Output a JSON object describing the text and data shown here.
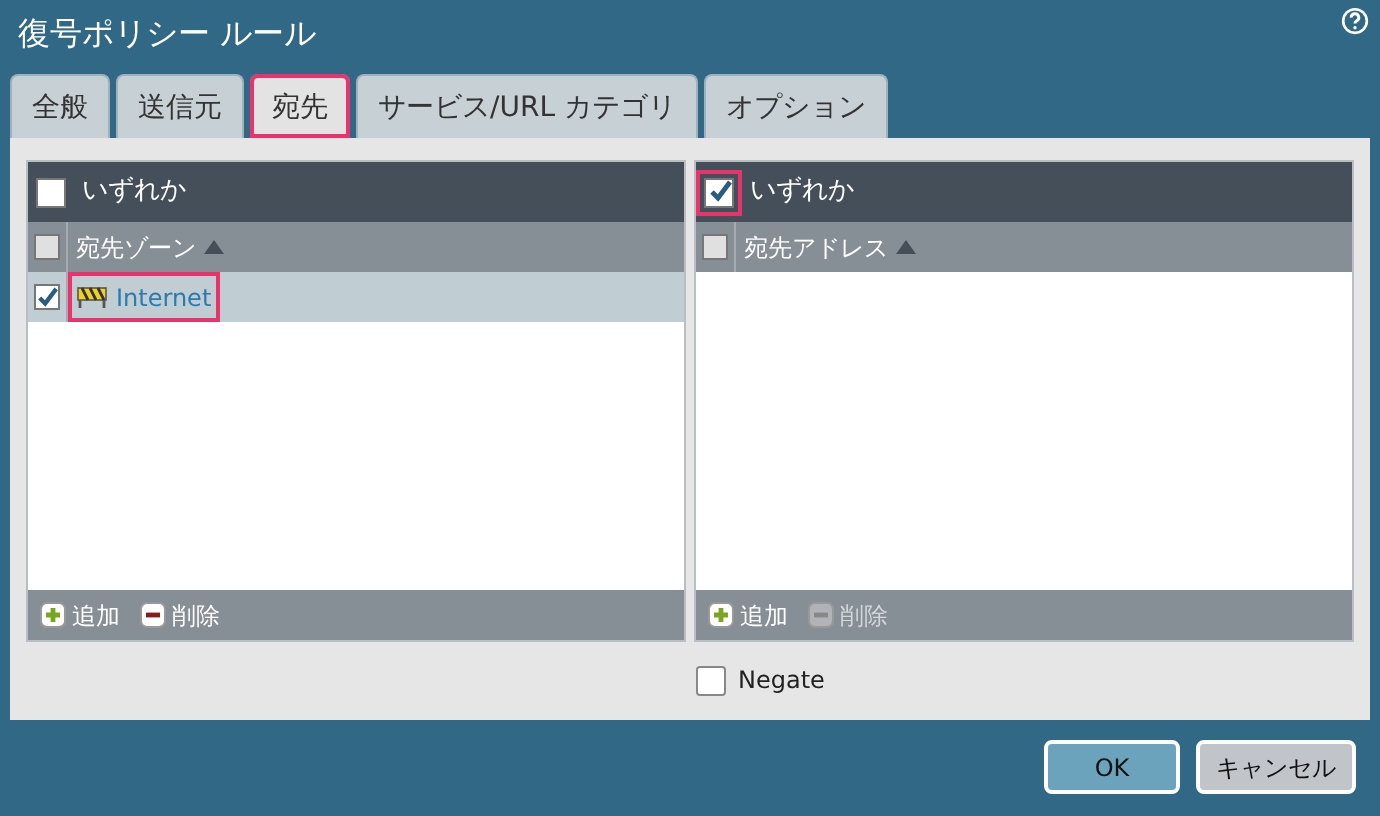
{
  "window": {
    "title": "復号ポリシー ルール"
  },
  "tabs": [
    {
      "label": "全般",
      "selected": false,
      "highlighted": false
    },
    {
      "label": "送信元",
      "selected": false,
      "highlighted": false
    },
    {
      "label": "宛先",
      "selected": true,
      "highlighted": true
    },
    {
      "label": "サービス/URL カテゴリ",
      "selected": false,
      "highlighted": false
    },
    {
      "label": "オプション",
      "selected": false,
      "highlighted": false
    }
  ],
  "panels": [
    {
      "any": {
        "label": "いずれか",
        "checked": false,
        "highlighted": false
      },
      "column": {
        "label": "宛先ゾーン",
        "checked": false
      },
      "rows": [
        {
          "label": "Internet",
          "checked": true,
          "selected": true,
          "highlighted": true
        }
      ],
      "actions": [
        {
          "label": "追加",
          "kind": "add",
          "disabled": false
        },
        {
          "label": "削除",
          "kind": "delete",
          "disabled": false
        }
      ]
    },
    {
      "any": {
        "label": "いずれか",
        "checked": true,
        "highlighted": true
      },
      "column": {
        "label": "宛先アドレス",
        "checked": false
      },
      "actions": [
        {
          "label": "追加",
          "kind": "add",
          "disabled": false
        },
        {
          "label": "削除",
          "kind": "delete",
          "disabled": true
        }
      ]
    }
  ],
  "negate": {
    "label": "Negate",
    "checked": false
  },
  "buttons": [
    {
      "label": "OK",
      "kind": "primary"
    },
    {
      "label": "キャンセル",
      "kind": "secondary"
    }
  ]
}
